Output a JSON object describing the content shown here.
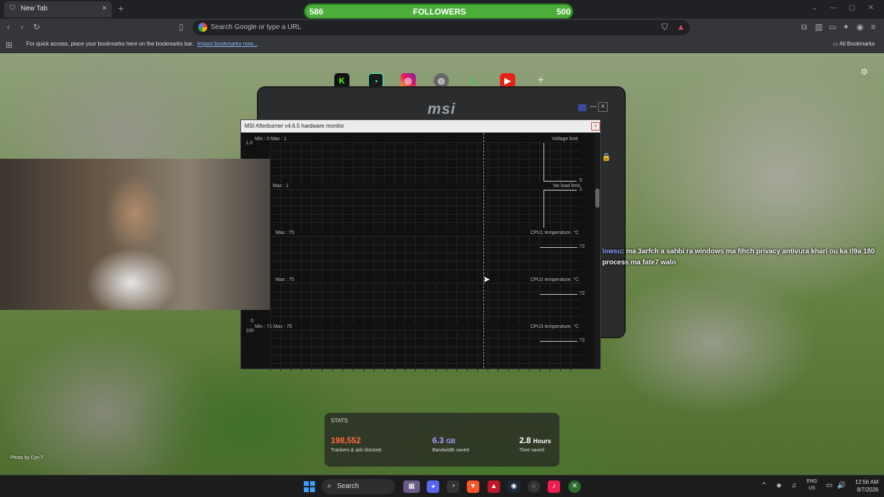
{
  "browser": {
    "tab_title": "New Tab",
    "tab_close": "×",
    "new_tab": "+",
    "omnibox_placeholder": "Search Google or type a URL",
    "bookmarks_text": "For quick access, place your bookmarks here on the bookmarks bar.",
    "bookmarks_link": "Import bookmarks now...",
    "all_bookmarks": "All Bookmarks"
  },
  "followers": {
    "current": "586",
    "label": "FOLLOWERS",
    "goal": "500"
  },
  "shortcuts": [
    "K",
    "",
    "",
    "",
    "L",
    "▶",
    "+"
  ],
  "msi": {
    "logo": "msi",
    "close": "×",
    "monitor_title": "MSI Afterburner v4.6.5 hardware monitor",
    "monitor_close": "×",
    "graphs": [
      {
        "left_label": "Min : 0   Max : 1",
        "top_value": "1.0",
        "name": "Voltage limit",
        "end_value": "0"
      },
      {
        "left_label": "Max : 1",
        "top_value": "",
        "name": "No load limit",
        "end_value": "1"
      },
      {
        "left_label": "Max : 75",
        "top_value": "",
        "name": "CPU1 temperature, °C",
        "end_value": "72"
      },
      {
        "left_label": "Max : 75",
        "top_value": "",
        "name": "CPU2 temperature, °C",
        "end_value": "72"
      },
      {
        "left_label": "Min : 71   Max : 75",
        "top_value": "100",
        "name": "CPU3 temperature, °C",
        "end_value": "72"
      }
    ],
    "axis_zero": "0"
  },
  "chat": {
    "user": "lowsu",
    "message": ": ma 3arfch a sahbi ra windows ma fihch privacy antivura khari ou ka tl9a 180 process ma fate7 walo"
  },
  "stats": {
    "title": "STATS",
    "trackers_value": "198,552",
    "trackers_label": "Trackers & ads blocked",
    "bandwidth_value": "6.3",
    "bandwidth_unit": "GB",
    "bandwidth_label": "Bandwidth saved",
    "time_value": "2.8",
    "time_unit": "Hours",
    "time_label": "Time saved",
    "colors": {
      "trackers": "#ff6b3d",
      "bandwidth": "#a99dff",
      "time": "#ffffff"
    }
  },
  "photo_credit": "Photo by Cyn T",
  "taskbar": {
    "search_label": "Search",
    "lang_line1": "ENG",
    "lang_line2": "US",
    "time": "12:56 AM",
    "date": "8/7/2026"
  }
}
